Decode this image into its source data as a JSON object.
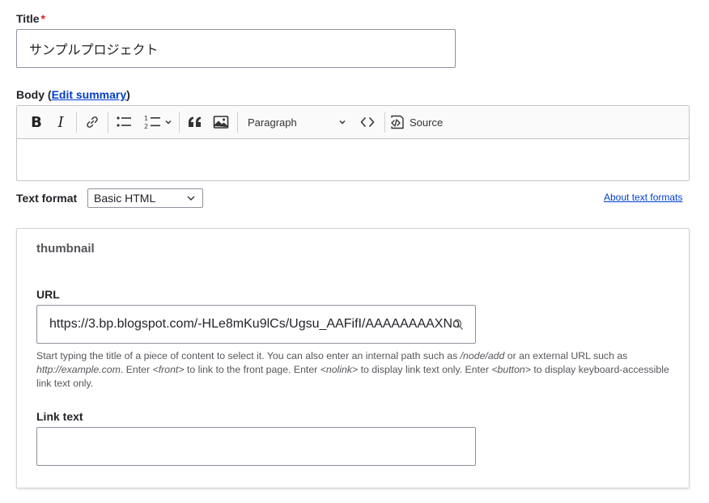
{
  "title_field": {
    "label": "Title",
    "required_mark": "*",
    "value": "サンプルプロジェクト"
  },
  "body_field": {
    "label_prefix": "Body (",
    "edit_summary_link": "Edit summary",
    "label_suffix": ")",
    "toolbar": {
      "paragraph_label": "Paragraph",
      "source_label": "Source"
    }
  },
  "text_format": {
    "label": "Text format",
    "selected": "Basic HTML",
    "about_link": "About text formats"
  },
  "thumbnail": {
    "legend": "thumbnail",
    "url_label": "URL",
    "url_value": "https://3.bp.blogspot.com/-HLe8mKu9lCs/Ugsu_AAFifI/AAAAAAAAXNo",
    "description": {
      "part1": "Start typing the title of a piece of content to select it. You can also enter an internal path such as ",
      "em1": "/node/add",
      "part2": " or an external URL such as ",
      "em2": "http://example.com",
      "part3": ". Enter ",
      "em3": "<front>",
      "part4": " to link to the front page. Enter ",
      "em4": "<nolink>",
      "part5": " to display link text only. Enter ",
      "em5": "<button>",
      "part6": " to display keyboard-accessible link text only."
    },
    "link_text_label": "Link text",
    "link_text_value": ""
  }
}
